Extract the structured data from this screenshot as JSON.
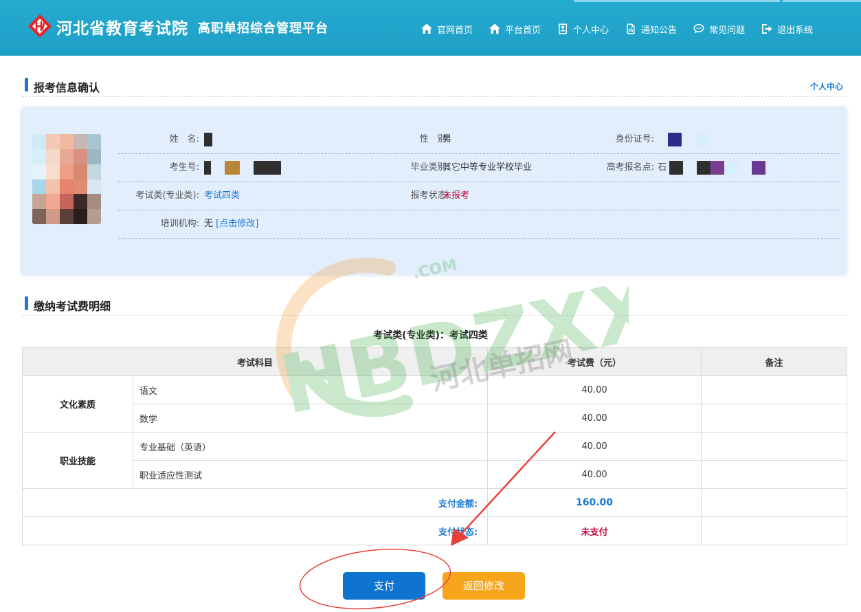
{
  "header": {
    "brand": "河北省教育考试院",
    "subtitle": "高职单招综合管理平台",
    "nav": [
      {
        "label": "官网首页",
        "icon": "home-icon"
      },
      {
        "label": "平台首页",
        "icon": "home-icon"
      },
      {
        "label": "个人中心",
        "icon": "user-card-icon"
      },
      {
        "label": "通知公告",
        "icon": "document-icon"
      },
      {
        "label": "常见问题",
        "icon": "chat-bubble-icon"
      },
      {
        "label": "退出系统",
        "icon": "logout-icon"
      }
    ]
  },
  "confirm": {
    "title": "报考信息确认",
    "link": "个人中心",
    "fields": {
      "name_label": "姓　名:",
      "gender_label": "性　别:",
      "gender_value": "男",
      "id_label": "身份证号:",
      "exam_no_label": "考生号:",
      "grad_label": "毕业类别:",
      "grad_value": "其它中等专业学校毕业",
      "site_label": "高考报名点:",
      "site_prefix": "石",
      "category_label": "考试类(专业类):",
      "category_value": "考试四类",
      "status_label": "报考状态:",
      "status_value": "未报考",
      "training_label": "培训机构:",
      "training_value": "无",
      "training_edit": "[点击修改]"
    }
  },
  "fees": {
    "title": "缴纳考试费明细",
    "caption": "考试类(专业类)：考试四类",
    "headers": {
      "subject": "考试科目",
      "fee": "考试费（元）",
      "remark": "备注"
    },
    "groups": [
      {
        "name": "文化素质",
        "rows": [
          {
            "subject": "语文",
            "fee": "40.00"
          },
          {
            "subject": "数学",
            "fee": "40.00"
          }
        ]
      },
      {
        "name": "职业技能",
        "rows": [
          {
            "subject": "专业基础（英语）",
            "fee": "40.00"
          },
          {
            "subject": "职业适应性测试",
            "fee": "40.00"
          }
        ]
      }
    ],
    "total_label": "支付金额:",
    "total_value": "160.00",
    "pay_status_label": "支付状态:",
    "pay_status_value": "未支付"
  },
  "actions": {
    "pay": "支付",
    "back": "返回修改"
  },
  "watermark": {
    "main": "HBDZXX",
    "dotcom": ".COM",
    "cn": "河北单招网"
  },
  "colors": {
    "header": "#1fa3ca",
    "accent": "#1a79d3",
    "danger": "#c4063c",
    "pay": "#0f74d0",
    "back": "#f7a51a",
    "annotation": "#e8413c"
  }
}
